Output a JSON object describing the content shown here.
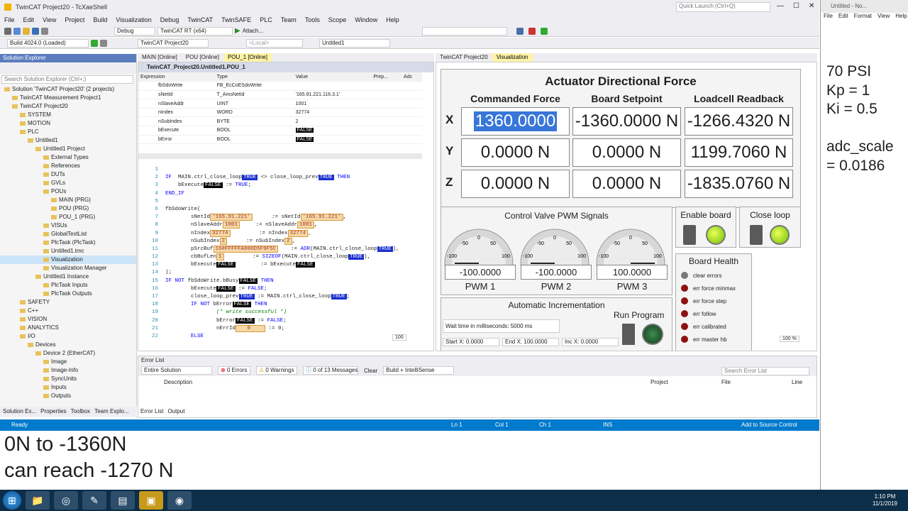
{
  "window": {
    "title": "TwinCAT Project20 - TcXaeShell",
    "quick_launch": "Quick Launch (Ctrl+Q)"
  },
  "menu": [
    "File",
    "Edit",
    "View",
    "Project",
    "Build",
    "Visualization",
    "Debug",
    "TwinCAT",
    "TwinSAFE",
    "PLC",
    "Team",
    "Tools",
    "Scope",
    "Window",
    "Help"
  ],
  "toolbar": {
    "config": "Debug",
    "platform": "TwinCAT RT (x64)",
    "attach": "Attach...",
    "build": "Build 4024.0 (Loaded)",
    "project": "TwinCAT Project20",
    "local": "<Local>",
    "target": "Untitled1"
  },
  "solution_explorer": {
    "title": "Solution Explorer",
    "search_placeholder": "Search Solution Explorer (Ctrl+;)",
    "items": [
      "Solution 'TwinCAT Project20' (2 projects)",
      "TwinCAT Measurement Project1",
      "TwinCAT Project20",
      "SYSTEM",
      "MOTION",
      "PLC",
      "Untitled1",
      "Untitled1 Project",
      "External Types",
      "References",
      "DUTs",
      "GVLs",
      "POUs",
      "MAIN (PRG)",
      "POU (PRG)",
      "POU_1 (PRG)",
      "VISUs",
      "GlobalTextList",
      "PlcTask (PlcTask)",
      "Untitled1.tmc",
      "Visualization",
      "Visualization Manager",
      "Untitled1 Instance",
      "PlcTask Inputs",
      "PlcTask Outputs",
      "SAFETY",
      "C++",
      "VISION",
      "ANALYTICS",
      "I/O",
      "Devices",
      "Device 2 (EtherCAT)",
      "Image",
      "Image-Info",
      "SyncUnits",
      "Inputs",
      "Outputs"
    ],
    "bottom_tabs": [
      "Solution Ex...",
      "Properties",
      "Toolbox",
      "Team Explo..."
    ]
  },
  "editor": {
    "tabs": [
      "MAIN [Online]",
      "POU [Online]",
      "POU_1 [Online]"
    ],
    "path": "TwinCAT_Project20.Untitled1.POU_1",
    "watch_headers": [
      "Expression",
      "Type",
      "Value",
      "Prep...",
      "Adc"
    ],
    "watch_rows": [
      [
        "fbSdoWrite",
        "FB_EcCoESdoWrite",
        ""
      ],
      [
        "sNetId",
        "T_AmsNetId",
        "'165.91.221.116.3.1'"
      ],
      [
        "nSlaveAddr",
        "UINT",
        "1001"
      ],
      [
        "nIndex",
        "WORD",
        "32774"
      ],
      [
        "nSubIndex",
        "BYTE",
        "2"
      ],
      [
        "bExecute",
        "BOOL",
        "FALSE"
      ],
      [
        "bError",
        "BOOL",
        "FALSE"
      ]
    ],
    "zoom": "100"
  },
  "visu": {
    "tabs": [
      "TwinCAT Project20",
      "Visualization"
    ],
    "title": "Actuator Directional Force",
    "col_headers": [
      "Commanded Force",
      "Board Setpoint",
      "Loadcell Readback"
    ],
    "rows": [
      {
        "axis": "X",
        "cmd": "1360.0000",
        "set": "-1360.0000 N",
        "read": "-1266.4320 N"
      },
      {
        "axis": "Y",
        "cmd": "0.0000 N",
        "set": "0.0000 N",
        "read": "1199.7060 N"
      },
      {
        "axis": "Z",
        "cmd": "0.0000 N",
        "set": "0.0000 N",
        "read": "-1835.0760 N"
      }
    ],
    "pwm_title": "Control Valve PWM Signals",
    "pwm": [
      {
        "value": "-100.0000",
        "label": "PWM 1",
        "level": -100
      },
      {
        "value": "-100.0000",
        "label": "PWM 2",
        "level": -100
      },
      {
        "value": "100.0000",
        "label": "PWM 3",
        "level": 100
      }
    ],
    "gauge_ticks": [
      "-50",
      "0",
      "50",
      "-100",
      "100"
    ],
    "enable_board": "Enable board",
    "close_loop": "Close loop",
    "board_health_title": "Board Health",
    "board_health": [
      "clear errors",
      "err force minmax",
      "err force step",
      "err follow",
      "err calibrated",
      "err master hb"
    ],
    "auto_inc_title": "Automatic Incrementation",
    "wait_time": "Wait time in milliseconds: 5000 ms",
    "run_program": "Run Program",
    "start_x": "Start X: 0.0000",
    "end_x": "End X: 100.0000",
    "inc_x": "Inc X: 0.0000",
    "zoom": "100 %"
  },
  "error_list": {
    "title": "Error List",
    "scope": "Entire Solution",
    "errors": "0 Errors",
    "warnings": "0 Warnings",
    "messages": "0 of 13 Messages",
    "clear": "Clear",
    "build": "Build + IntelliSense",
    "search": "Search Error List",
    "headers": [
      "Description",
      "Project",
      "File",
      "Line"
    ],
    "tabs": [
      "Error List",
      "Output"
    ]
  },
  "status": {
    "ready": "Ready",
    "ln": "Ln 1",
    "col": "Col 1",
    "ch": "Ch 1",
    "ins": "INS",
    "source": "Add to Source Control"
  },
  "notes_bottom": [
    "0N to -1360N",
    "can reach -1270 N"
  ],
  "notepad": {
    "title": "Untitled - No...",
    "menu": [
      "File",
      "Edit",
      "Format",
      "View",
      "Help"
    ],
    "lines": [
      "70 PSI",
      "Kp = 1",
      "Ki = 0.5",
      "",
      "adc_scale",
      "= 0.0186"
    ]
  },
  "taskbar": {
    "time": "1:10 PM",
    "date": "11/1/2019"
  }
}
